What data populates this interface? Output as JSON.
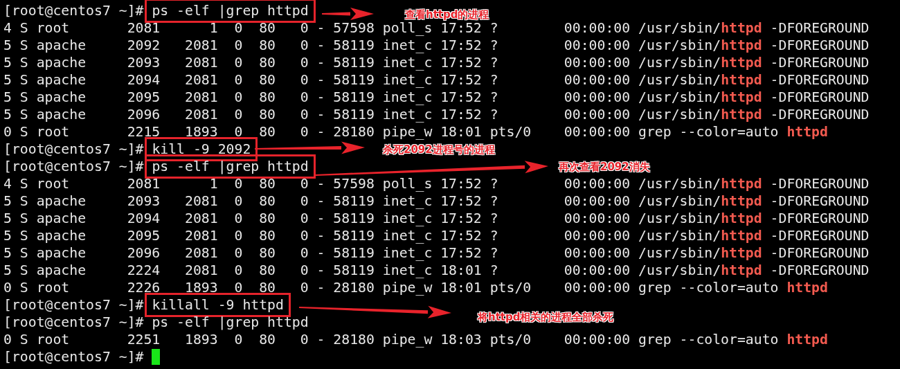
{
  "terminal": {
    "lines": [
      {
        "kind": "prompt",
        "prompt": "[root@centos7 ~]#",
        "command": "ps -elf |grep httpd",
        "annotation": {
          "note": "查看httpd的进程"
        }
      },
      {
        "kind": "output",
        "text": "4 S root       2081      1  0  80   0 - 57598 poll_s 17:52 ?        00:00:00 /usr/sbin/**httpd** -DFOREGROUND"
      },
      {
        "kind": "output",
        "text": "5 S apache     2092   2081  0  80   0 - 58119 inet_c 17:52 ?        00:00:00 /usr/sbin/**httpd** -DFOREGROUND"
      },
      {
        "kind": "output",
        "text": "5 S apache     2093   2081  0  80   0 - 58119 inet_c 17:52 ?        00:00:00 /usr/sbin/**httpd** -DFOREGROUND"
      },
      {
        "kind": "output",
        "text": "5 S apache     2094   2081  0  80   0 - 58119 inet_c 17:52 ?        00:00:00 /usr/sbin/**httpd** -DFOREGROUND"
      },
      {
        "kind": "output",
        "text": "5 S apache     2095   2081  0  80   0 - 58119 inet_c 17:52 ?        00:00:00 /usr/sbin/**httpd** -DFOREGROUND"
      },
      {
        "kind": "output",
        "text": "5 S apache     2096   2081  0  80   0 - 58119 inet_c 17:52 ?        00:00:00 /usr/sbin/**httpd** -DFOREGROUND"
      },
      {
        "kind": "output",
        "text": "0 S root       2215   1893  0  80   0 - 28180 pipe_w 18:01 pts/0    00:00:00 grep --color=auto **httpd**"
      },
      {
        "kind": "prompt",
        "prompt": "[root@centos7 ~]#",
        "command": "kill -9 2092",
        "annotation": {
          "note": "杀死2092进程号的进程"
        }
      },
      {
        "kind": "prompt",
        "prompt": "[root@centos7 ~]#",
        "command": "ps -elf |grep httpd",
        "annotation": {
          "note": "再次查看2092消失"
        }
      },
      {
        "kind": "output",
        "text": "4 S root       2081      1  0  80   0 - 57598 poll_s 17:52 ?        00:00:00 /usr/sbin/**httpd** -DFOREGROUND"
      },
      {
        "kind": "output",
        "text": "5 S apache     2093   2081  0  80   0 - 58119 inet_c 17:52 ?        00:00:00 /usr/sbin/**httpd** -DFOREGROUND"
      },
      {
        "kind": "output",
        "text": "5 S apache     2094   2081  0  80   0 - 58119 inet_c 17:52 ?        00:00:00 /usr/sbin/**httpd** -DFOREGROUND"
      },
      {
        "kind": "output",
        "text": "5 S apache     2095   2081  0  80   0 - 58119 inet_c 17:52 ?        00:00:00 /usr/sbin/**httpd** -DFOREGROUND"
      },
      {
        "kind": "output",
        "text": "5 S apache     2096   2081  0  80   0 - 58119 inet_c 17:52 ?        00:00:00 /usr/sbin/**httpd** -DFOREGROUND"
      },
      {
        "kind": "output",
        "text": "5 S apache     2224   2081  0  80   0 - 58119 inet_c 18:01 ?        00:00:00 /usr/sbin/**httpd** -DFOREGROUND"
      },
      {
        "kind": "output",
        "text": "0 S root       2226   1893  0  80   0 - 28180 pipe_w 18:01 pts/0    00:00:00 grep --color=auto **httpd**"
      },
      {
        "kind": "prompt",
        "prompt": "[root@centos7 ~]#",
        "command": "killall -9 httpd",
        "annotation": {
          "note": "将httpd相关的进程全部杀死"
        }
      },
      {
        "kind": "prompt",
        "prompt": "[root@centos7 ~]#",
        "command": "ps -elf |grep httpd"
      },
      {
        "kind": "output",
        "text": "0 S root       2251   1893  0  80   0 - 28180 pipe_w 18:03 pts/0    00:00:00 grep --color=auto **httpd**"
      },
      {
        "kind": "input",
        "prompt": "[root@centos7 ~]#"
      }
    ]
  }
}
